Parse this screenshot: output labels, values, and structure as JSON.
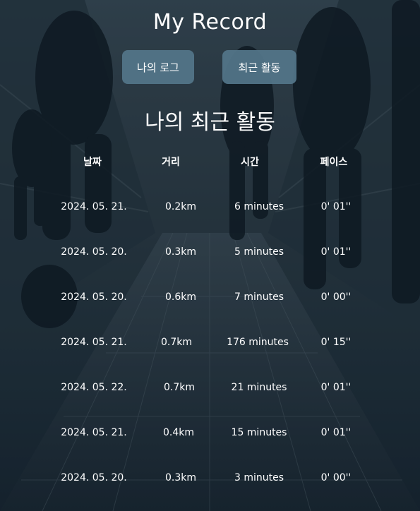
{
  "header": {
    "title": "My Record"
  },
  "nav": {
    "log_label": "나의 로그",
    "recent_label": "최근 활동"
  },
  "section": {
    "title": "나의 최근 활동"
  },
  "table": {
    "columns": [
      "날짜",
      "거리",
      "시간",
      "페이스"
    ],
    "rows": [
      {
        "date": "2024. 05. 21.",
        "distance": "0.2km",
        "time": "6 minutes",
        "pace": "0' 01''"
      },
      {
        "date": "2024. 05. 20.",
        "distance": "0.3km",
        "time": "5 minutes",
        "pace": "0' 01''"
      },
      {
        "date": "2024. 05. 20.",
        "distance": "0.6km",
        "time": "7 minutes",
        "pace": "0' 00''"
      },
      {
        "date": "2024. 05. 21.",
        "distance": "0.7km",
        "time": "176 minutes",
        "pace": "0' 15''"
      },
      {
        "date": "2024. 05. 22.",
        "distance": "0.7km",
        "time": "21 minutes",
        "pace": "0' 01''"
      },
      {
        "date": "2024. 05. 21.",
        "distance": "0.4km",
        "time": "15 minutes",
        "pace": "0' 01''"
      },
      {
        "date": "2024. 05. 20.",
        "distance": "0.3km",
        "time": "3 minutes",
        "pace": "0' 00''"
      }
    ]
  },
  "theme": {
    "button_color": "#54768a",
    "text_color": "#ffffff",
    "background_color": "#2c3b44"
  }
}
